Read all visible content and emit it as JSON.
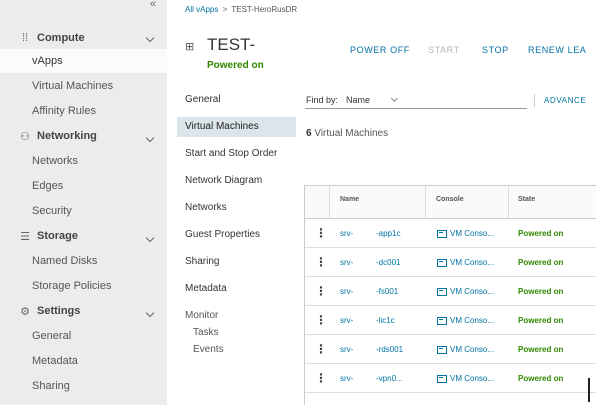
{
  "leftnav": {
    "sections": [
      {
        "label": "Compute",
        "icon": "grid-icon",
        "items": [
          "vApps",
          "Virtual Machines",
          "Affinity Rules"
        ]
      },
      {
        "label": "Networking",
        "icon": "network-icon",
        "items": [
          "Networks",
          "Edges",
          "Security"
        ]
      },
      {
        "label": "Storage",
        "icon": "database-icon",
        "items": [
          "Named Disks",
          "Storage Policies"
        ]
      },
      {
        "label": "Settings",
        "icon": "gear-icon",
        "items": [
          "General",
          "Metadata",
          "Sharing"
        ]
      }
    ]
  },
  "breadcrumb": {
    "link": "All vApps",
    "separator": ">",
    "current": "TEST-HeroRusDR"
  },
  "vapp": {
    "title": "TEST-",
    "status": "Powered on"
  },
  "actions": [
    {
      "label": "POWER OFF",
      "enabled": true
    },
    {
      "label": "START",
      "enabled": false
    },
    {
      "label": "STOP",
      "enabled": true
    },
    {
      "label": "RENEW LEA",
      "enabled": true
    }
  ],
  "subnav": {
    "items": [
      "General",
      "Virtual Machines",
      "Start and Stop Order",
      "Network Diagram",
      "Networks",
      "Guest Properties",
      "Sharing",
      "Metadata"
    ],
    "monitor": {
      "label": "Monitor",
      "children": [
        "Tasks",
        "Events"
      ]
    }
  },
  "filter": {
    "label": "Find by:",
    "selected": "Name",
    "advanced": "ADVANCE"
  },
  "summary": {
    "count": "6",
    "text": "Virtual Machines"
  },
  "table": {
    "columns": [
      "Name",
      "Console",
      "State"
    ],
    "rows": [
      {
        "name_prefix": "srv-",
        "name_suffix": "-app1c",
        "console": "VM Conso...",
        "state": "Powered on"
      },
      {
        "name_prefix": "srv-",
        "name_suffix": "-dc001",
        "console": "VM Conso...",
        "state": "Powered on"
      },
      {
        "name_prefix": "srv-",
        "name_suffix": "-fs001",
        "console": "VM Conso...",
        "state": "Powered on"
      },
      {
        "name_prefix": "srv-",
        "name_suffix": "-lic1c",
        "console": "VM Conso...",
        "state": "Powered on"
      },
      {
        "name_prefix": "srv-",
        "name_suffix": "-rds001",
        "console": "VM Conso...",
        "state": "Powered on"
      },
      {
        "name_prefix": "srv-",
        "name_suffix": "-vpn0...",
        "console": "VM Conso...",
        "state": "Powered on"
      }
    ]
  },
  "colors": {
    "accent": "#0072a3",
    "success": "#318700",
    "nav_bg": "#ececec",
    "subnav_active": "#dbe5ea"
  }
}
